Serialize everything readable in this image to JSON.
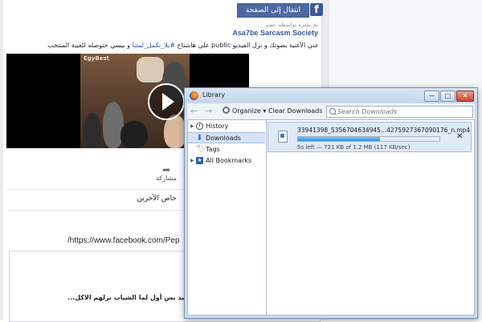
{
  "facebook": {
    "logo": "f",
    "home_button": "انتقال إلى الصفحة الرئيسية",
    "sponsored": "تم نشره بواسطة عشر",
    "page_name": "Asa7be Sarcasm Society",
    "post_text_before": "غني الأغنية بصوتك و نزل الفيديو public علي هاشتاج ",
    "post_hashtag": "#يلا_نكمل_لمتنا",
    "post_text_after": " و بيسي حتوصله للعيبة المنتخب",
    "video_watermark": "EgyBest",
    "share_label": "مشاركة",
    "others_label": "خاص الآخرين",
    "url_text": "/https://www.facebook.com/Pep",
    "comment_text": "جي و مفيد بس أول لما الشباب نزلهم الاكل..."
  },
  "library": {
    "title": "Library",
    "window_buttons": {
      "minimize": "—",
      "maximize": "□",
      "close": "✕"
    },
    "toolbar": {
      "back": "←",
      "forward": "→",
      "organize": "Organize",
      "clear_downloads": "Clear Downloads",
      "search_placeholder": "Search Downloads"
    },
    "tree": [
      {
        "label": "History",
        "icon": "clock-icon"
      },
      {
        "label": "Downloads",
        "icon": "download-arrow-icon",
        "selected": true
      },
      {
        "label": "Tags",
        "icon": "tag-icon"
      },
      {
        "label": "All Bookmarks",
        "icon": "bookmark-star-icon"
      }
    ],
    "download": {
      "filename": "33941398_5356704634945...4275927367090176_n.mp4",
      "progress_percent": 58,
      "status": "5s left — 721 KB of 1.2 MB (117 KB/sec)",
      "cancel": "✕"
    }
  }
}
